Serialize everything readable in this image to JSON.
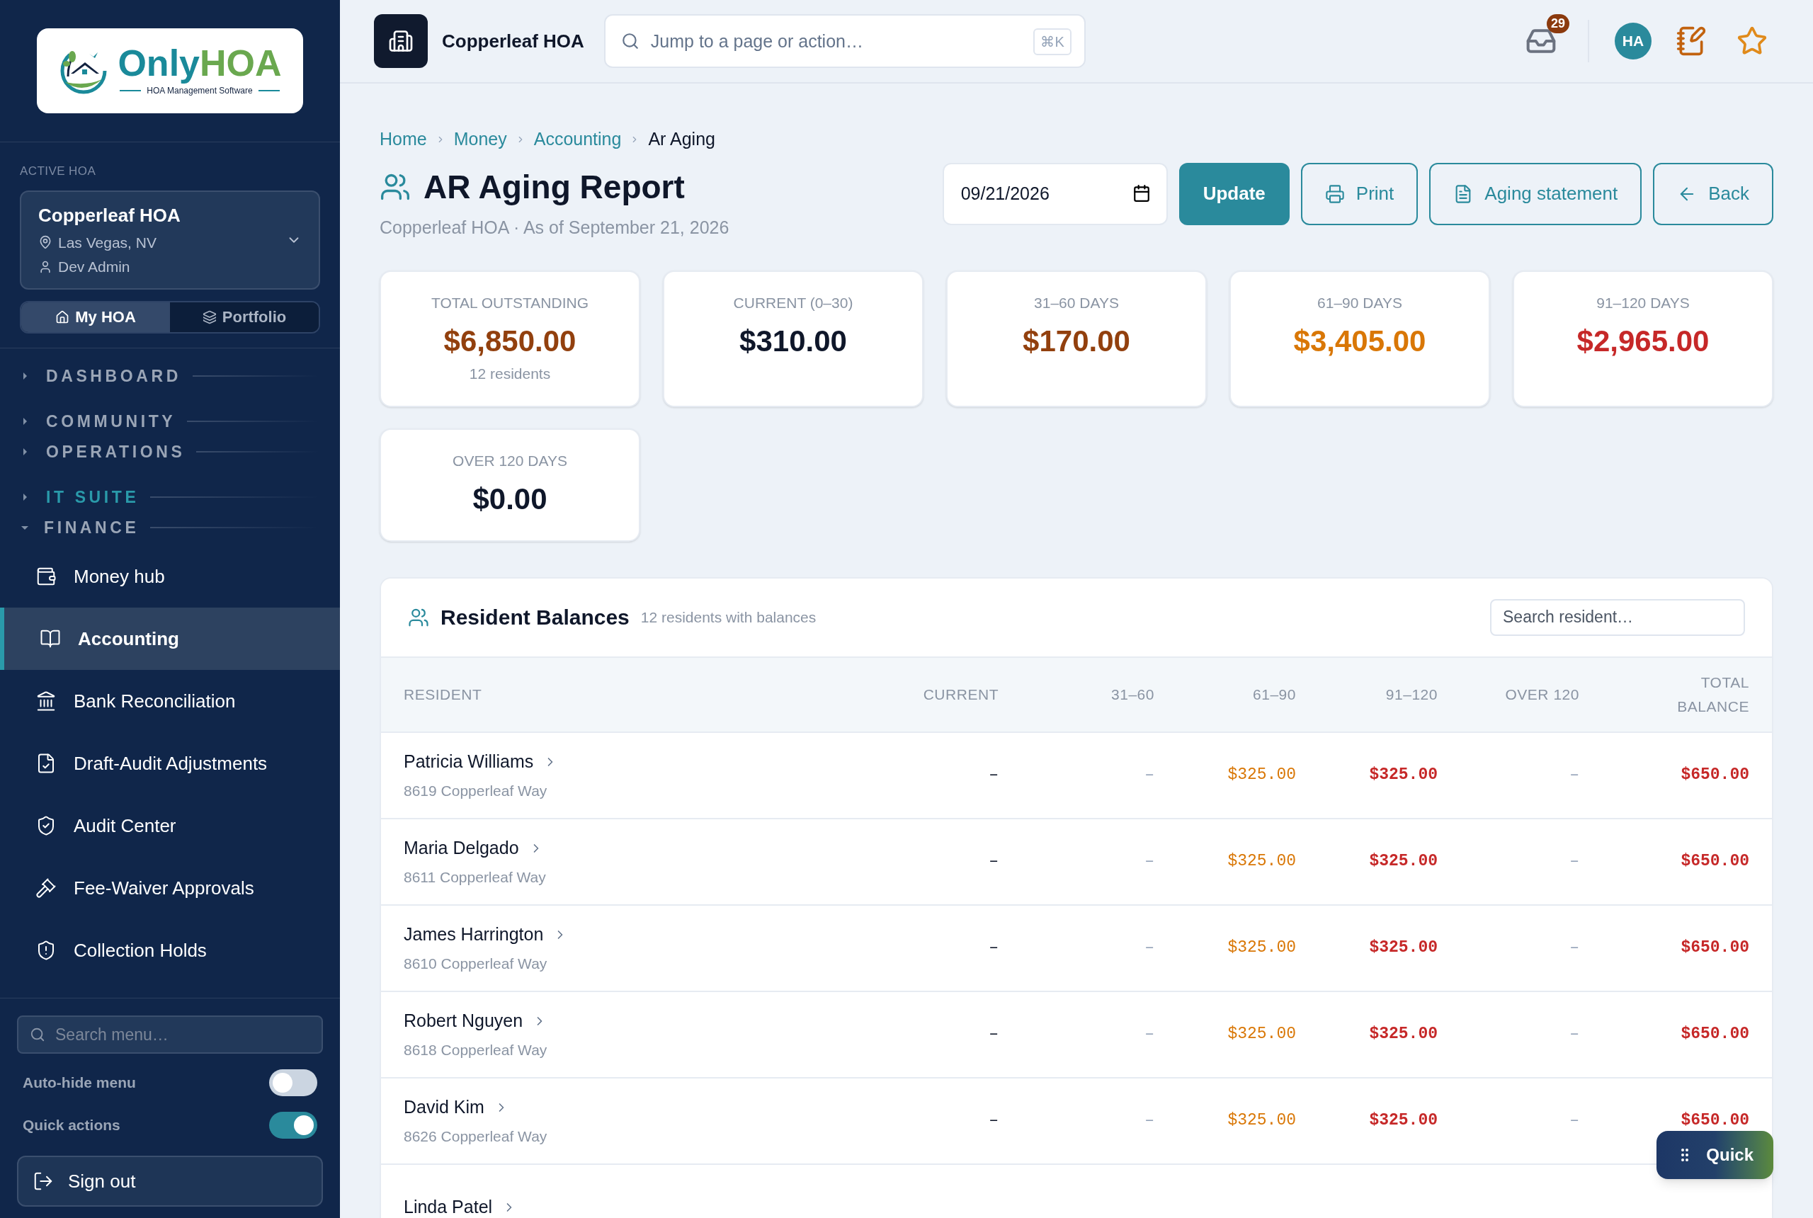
{
  "sidebar": {
    "logo": {
      "part1": "Only",
      "part2": "HOA",
      "tagline": "HOA Management Software"
    },
    "active_hoa_label": "ACTIVE HOA",
    "hoa": {
      "name": "Copperleaf HOA",
      "location": "Las Vegas, NV",
      "user": "Dev Admin"
    },
    "scope_tabs": [
      {
        "label": "My HOA",
        "selected": true
      },
      {
        "label": "Portfolio",
        "selected": false
      }
    ],
    "sections": [
      {
        "label": "DASHBOARD",
        "expanded": false,
        "highlighted": false
      },
      {
        "label": "COMMUNITY",
        "expanded": false,
        "highlighted": false
      },
      {
        "label": "OPERATIONS",
        "expanded": false,
        "highlighted": false
      },
      {
        "label": "IT SUITE",
        "expanded": false,
        "highlighted": true
      },
      {
        "label": "FINANCE",
        "expanded": true,
        "highlighted": false
      }
    ],
    "items": [
      {
        "label": "Money hub",
        "selected": false
      },
      {
        "label": "Accounting",
        "selected": true
      },
      {
        "label": "Bank Reconciliation",
        "selected": false
      },
      {
        "label": "Draft-Audit Adjustments",
        "selected": false
      },
      {
        "label": "Audit Center",
        "selected": false
      },
      {
        "label": "Fee-Waiver Approvals",
        "selected": false
      },
      {
        "label": "Collection Holds",
        "selected": false
      }
    ],
    "search": {
      "placeholder": "Search menu…"
    },
    "toggles": [
      {
        "label": "Auto-hide menu",
        "on": false
      },
      {
        "label": "Quick actions",
        "on": true
      }
    ],
    "sign_out": "Sign out"
  },
  "header": {
    "hoa_name": "Copperleaf HOA",
    "search": {
      "placeholder": "Jump to a page or action…",
      "shortcut": "⌘K"
    },
    "inbox_badge": "29",
    "avatar": "HA"
  },
  "breadcrumbs": [
    "Home",
    "Money",
    "Accounting",
    "Ar Aging"
  ],
  "page": {
    "title": "AR Aging Report",
    "subtitle": "Copperleaf HOA · As of September 21, 2026",
    "date": "09/21/2026",
    "buttons": [
      {
        "label": "Update",
        "kind": "primary"
      },
      {
        "label": "Print",
        "kind": "print"
      },
      {
        "label": "Aging statement",
        "kind": "statement"
      },
      {
        "label": "Back",
        "kind": "back"
      }
    ]
  },
  "stats": [
    {
      "label": "TOTAL OUTSTANDING",
      "value": "$6,850.00",
      "note": "12 residents",
      "color": "#92400e"
    },
    {
      "label": "CURRENT (0–30)",
      "value": "$310.00",
      "color": "#0f172a"
    },
    {
      "label": "31–60 DAYS",
      "value": "$170.00",
      "color": "#92400e"
    },
    {
      "label": "61–90 DAYS",
      "value": "$3,405.00",
      "color": "#d97706"
    },
    {
      "label": "91–120 DAYS",
      "value": "$2,965.00",
      "color": "#c62828"
    },
    {
      "label": "OVER 120 DAYS",
      "value": "$0.00",
      "color": "#0f172a"
    }
  ],
  "balances": {
    "title": "Resident Balances",
    "subtitle": "12 residents with balances",
    "search": {
      "placeholder": "Search resident…"
    },
    "columns": [
      "RESIDENT",
      "CURRENT",
      "31–60",
      "61–90",
      "91–120",
      "OVER 120",
      "TOTAL BALANCE"
    ],
    "rows": [
      {
        "name": "Patricia Williams",
        "address": "8619 Copperleaf Way",
        "cells": [
          "–",
          "–",
          "$325.00",
          "$325.00",
          "–",
          "$650.00"
        ]
      },
      {
        "name": "Maria Delgado",
        "address": "8611 Copperleaf Way",
        "cells": [
          "–",
          "–",
          "$325.00",
          "$325.00",
          "–",
          "$650.00"
        ]
      },
      {
        "name": "James Harrington",
        "address": "8610 Copperleaf Way",
        "cells": [
          "–",
          "–",
          "$325.00",
          "$325.00",
          "–",
          "$650.00"
        ]
      },
      {
        "name": "Robert Nguyen",
        "address": "8618 Copperleaf Way",
        "cells": [
          "–",
          "–",
          "$325.00",
          "$325.00",
          "–",
          "$650.00"
        ]
      },
      {
        "name": "David Kim",
        "address": "8626 Copperleaf Way",
        "cells": [
          "–",
          "–",
          "$325.00",
          "$325.00",
          "–",
          "$650.00"
        ]
      },
      {
        "name": "Linda Patel"
      }
    ]
  },
  "quick_button": "Quick"
}
